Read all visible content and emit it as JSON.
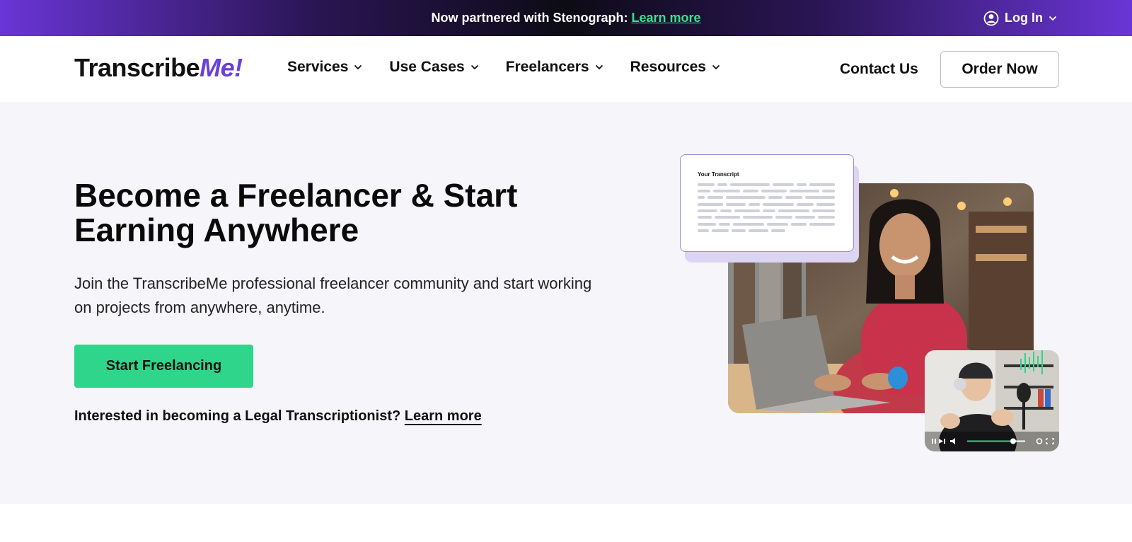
{
  "announcement": {
    "text": "Now partnered with Stenograph:",
    "link": "Learn more"
  },
  "login": {
    "label": "Log In"
  },
  "header": {
    "logo_main": "Transcribe",
    "logo_accent": "Me!",
    "nav": [
      "Services",
      "Use Cases",
      "Freelancers",
      "Resources"
    ],
    "contact": "Contact Us",
    "order": "Order Now"
  },
  "hero": {
    "title_line1": "Become a Freelancer & Start",
    "title_line2": "Earning Anywhere",
    "subtitle": "Join the TranscribeMe professional freelancer community and start working on projects from anywhere, anytime.",
    "cta": "Start Freelancing",
    "legal_text": "Interested in becoming a Legal Transcriptionist?",
    "legal_link": "Learn more"
  },
  "illustration": {
    "transcript_title": "Your Transcript"
  },
  "colors": {
    "accent_purple": "#6b3fd8",
    "cta_green": "#2fd58b",
    "link_green": "#3ee08f",
    "hero_bg": "#f5f5fa"
  }
}
